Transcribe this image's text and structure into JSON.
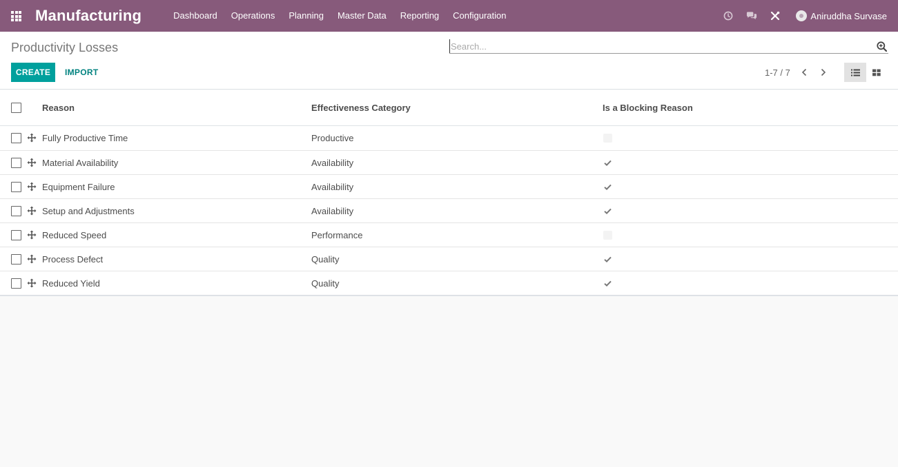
{
  "navbar": {
    "app_name": "Manufacturing",
    "menu": [
      "Dashboard",
      "Operations",
      "Planning",
      "Master Data",
      "Reporting",
      "Configuration"
    ],
    "user_name": "Aniruddha Survase"
  },
  "control_panel": {
    "breadcrumb": "Productivity Losses",
    "search_placeholder": "Search...",
    "create_label": "CREATE",
    "import_label": "IMPORT",
    "pager": "1-7 / 7"
  },
  "table": {
    "columns": [
      "Reason",
      "Effectiveness Category",
      "Is a Blocking Reason"
    ],
    "rows": [
      {
        "reason": "Fully Productive Time",
        "category": "Productive",
        "blocking": false
      },
      {
        "reason": "Material Availability",
        "category": "Availability",
        "blocking": true
      },
      {
        "reason": "Equipment Failure",
        "category": "Availability",
        "blocking": true
      },
      {
        "reason": "Setup and Adjustments",
        "category": "Availability",
        "blocking": true
      },
      {
        "reason": "Reduced Speed",
        "category": "Performance",
        "blocking": false
      },
      {
        "reason": "Process Defect",
        "category": "Quality",
        "blocking": true
      },
      {
        "reason": "Reduced Yield",
        "category": "Quality",
        "blocking": true
      }
    ]
  },
  "colors": {
    "navbar": "#875a7b",
    "primary_button": "#00a09d",
    "link": "#00827f"
  }
}
